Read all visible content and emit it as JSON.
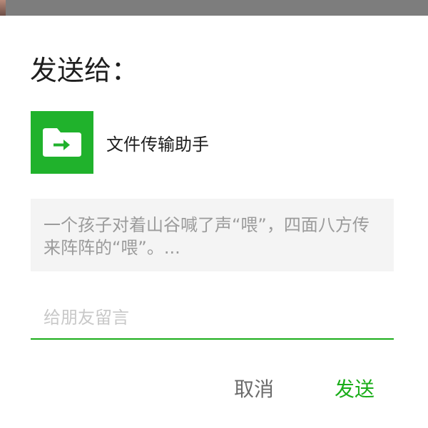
{
  "dialog": {
    "title": "发送给：",
    "recipient": {
      "name": "文件传输助手",
      "avatar_icon": "file-transfer-icon",
      "avatar_color": "#20b22c"
    },
    "message_preview": "一个孩子对着山谷喊了声“喂”，四面八方传来阵阵的“喂”。...",
    "input": {
      "placeholder": "给朋友留言",
      "value": ""
    },
    "buttons": {
      "cancel_label": "取消",
      "send_label": "发送"
    },
    "accent_color": "#1aad19"
  }
}
